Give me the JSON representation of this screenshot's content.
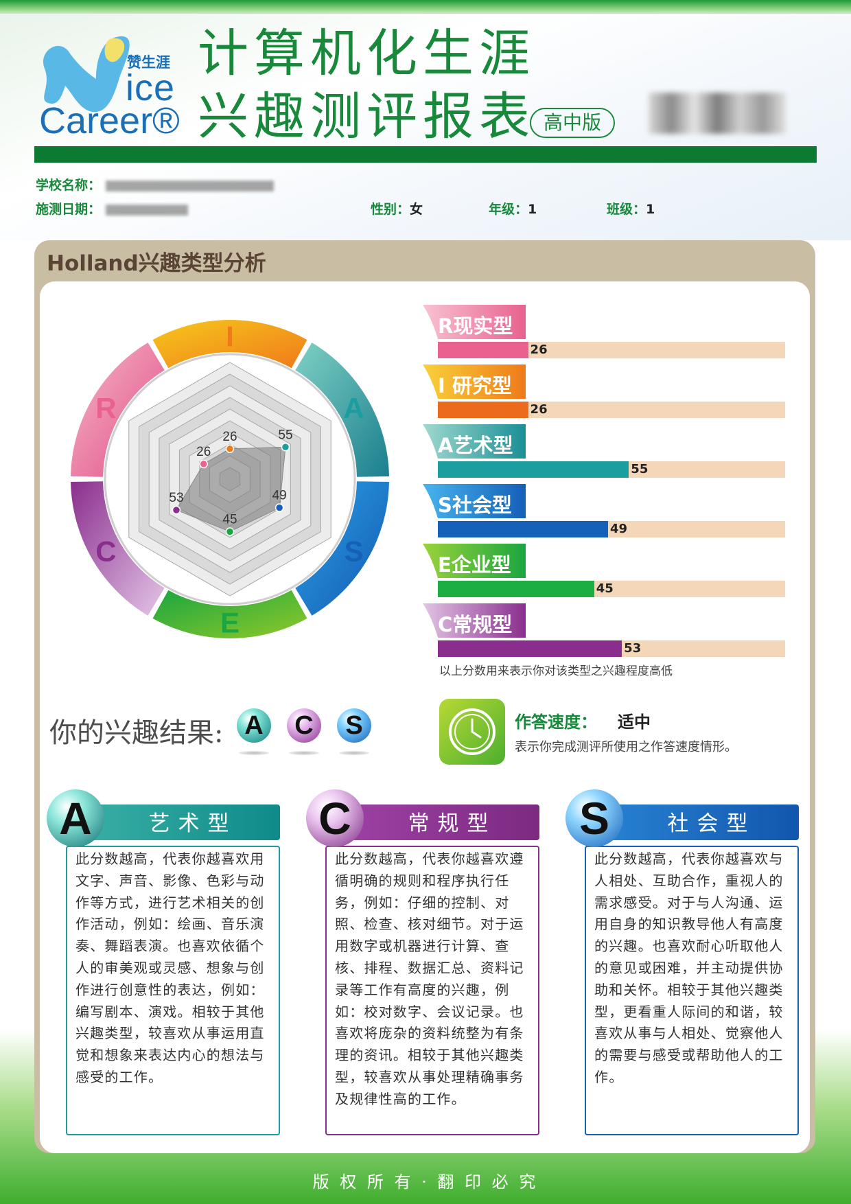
{
  "header": {
    "logo_cn": "赞生涯",
    "logo_en_1": "ice",
    "logo_en_2": "Career®",
    "title_line1": "计算机化生涯",
    "title_line2": "兴趣测评报表",
    "edition": "高中版"
  },
  "info": {
    "school_label": "学校名称：",
    "date_label": "施测日期：",
    "gender_label": "性别：",
    "gender_value": "女",
    "grade_label": "年级：",
    "grade_value": "1",
    "class_label": "班级：",
    "class_value": "1"
  },
  "section_title": "Holland兴趣类型分析",
  "ring_letters": [
    "I",
    "A",
    "S",
    "E",
    "C",
    "R"
  ],
  "colors": {
    "R": "#e8618f",
    "I": "#ef7a1a",
    "A": "#1a9ea0",
    "S": "#1560b8",
    "E": "#1aa640",
    "C": "#8a2e8e"
  },
  "chart_data": {
    "type": "radar",
    "categories": [
      "I",
      "A",
      "S",
      "E",
      "C",
      "R"
    ],
    "values": [
      26,
      55,
      49,
      45,
      53,
      26
    ],
    "range": [
      0,
      100
    ]
  },
  "bars": [
    {
      "label": "R现实型",
      "value": 26
    },
    {
      "label": "I 研究型",
      "value": 26
    },
    {
      "label": "A艺术型",
      "value": 55
    },
    {
      "label": "S社会型",
      "value": 49
    },
    {
      "label": "E企业型",
      "value": 45
    },
    {
      "label": "C常规型",
      "value": 53
    }
  ],
  "bar_note": "以上分数用来表示你对该类型之兴趣程度高低",
  "result": {
    "label": "你的兴趣结果:",
    "codes": [
      "A",
      "C",
      "S"
    ]
  },
  "speed": {
    "label": "作答速度：",
    "value": "适中",
    "note": "表示你完成测评所使用之作答速度情形。"
  },
  "cards": [
    {
      "letter": "A",
      "title": "艺术型",
      "text": "此分数越高，代表你越喜欢用文字、声音、影像、色彩与动作等方式，进行艺术相关的创作活动，例如：绘画、音乐演奏、舞蹈表演。也喜欢依循个人的审美观或灵感、想象与创作进行创意性的表达，例如：编写剧本、演戏。相较于其他兴趣类型，较喜欢从事运用直觉和想象来表达内心的想法与感受的工作。"
    },
    {
      "letter": "C",
      "title": "常规型",
      "text": "此分数越高，代表你越喜欢遵循明确的规则和程序执行任务，例如：仔细的控制、对照、检查、核对细节。对于运用数字或机器进行计算、查核、排程、数据汇总、资料记录等工作有高度的兴趣，例如：校对数字、会议记录。也喜欢将庞杂的资料统整为有条理的资讯。相较于其他兴趣类型，较喜欢从事处理精确事务及规律性高的工作。"
    },
    {
      "letter": "S",
      "title": "社会型",
      "text": "此分数越高，代表你越喜欢与人相处、互助合作，重视人的需求感受。对于与人沟通、运用自身的知识教导他人有高度的兴趣。也喜欢耐心听取他人的意见或困难，并主动提供协助和关怀。相较于其他兴趣类型，更看重人际间的和谐，较喜欢从事与人相处、觉察他人的需要与感受或帮助他人的工作。"
    }
  ],
  "footer": "版 权 所 有 · 翻 印 必 究"
}
